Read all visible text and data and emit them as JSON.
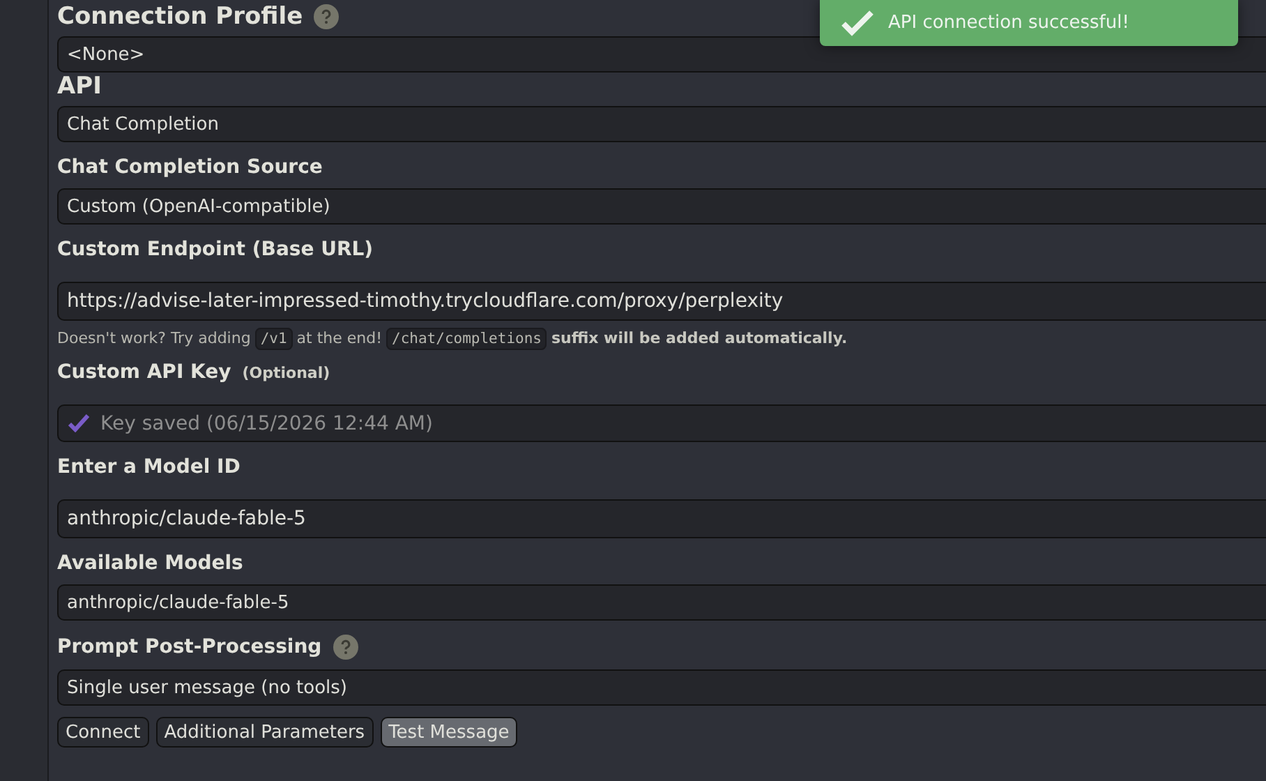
{
  "toast": {
    "text": "API connection successful!"
  },
  "sections": [
    {
      "kind": "heading",
      "label": "Connection Profile",
      "help": true
    },
    {
      "kind": "select",
      "value": "<None>"
    },
    {
      "kind": "heading",
      "label": "API",
      "help": false
    },
    {
      "kind": "select",
      "value": "Chat Completion"
    },
    {
      "kind": "label",
      "label": "Chat Completion Source",
      "help": false
    },
    {
      "kind": "select",
      "value": "Custom (OpenAI-compatible)"
    },
    {
      "kind": "label",
      "label": "Custom Endpoint (Base URL)",
      "help": false
    },
    {
      "kind": "input",
      "value": "https://advise-later-impressed-timothy.trycloudflare.com/proxy/perplexity"
    },
    {
      "kind": "hint",
      "parts": [
        {
          "kind": "text",
          "text": "Doesn't work? Try adding"
        },
        {
          "kind": "code",
          "text": "/v1"
        },
        {
          "kind": "text",
          "text": "at the end!"
        },
        {
          "kind": "code",
          "text": "/chat/completions"
        },
        {
          "kind": "bold",
          "text": "suffix will be added automatically."
        }
      ]
    },
    {
      "kind": "label",
      "label": "Custom API Key",
      "note": "(Optional)",
      "help": false
    },
    {
      "kind": "key",
      "placeholder": "Key saved (06/15/2026 12:44 AM)"
    },
    {
      "kind": "label",
      "label": "Enter a Model ID",
      "help": false
    },
    {
      "kind": "input",
      "value": "anthropic/claude-fable-5"
    },
    {
      "kind": "label",
      "label": "Available Models",
      "help": false
    },
    {
      "kind": "select",
      "value": "anthropic/claude-fable-5"
    },
    {
      "kind": "label",
      "label": "Prompt Post-Processing",
      "help": true
    },
    {
      "kind": "select",
      "value": "Single user message (no tools)"
    }
  ],
  "buttons": [
    {
      "label": "Connect",
      "active": false
    },
    {
      "label": "Additional Parameters",
      "active": false
    },
    {
      "label": "Test Message",
      "active": true
    }
  ]
}
